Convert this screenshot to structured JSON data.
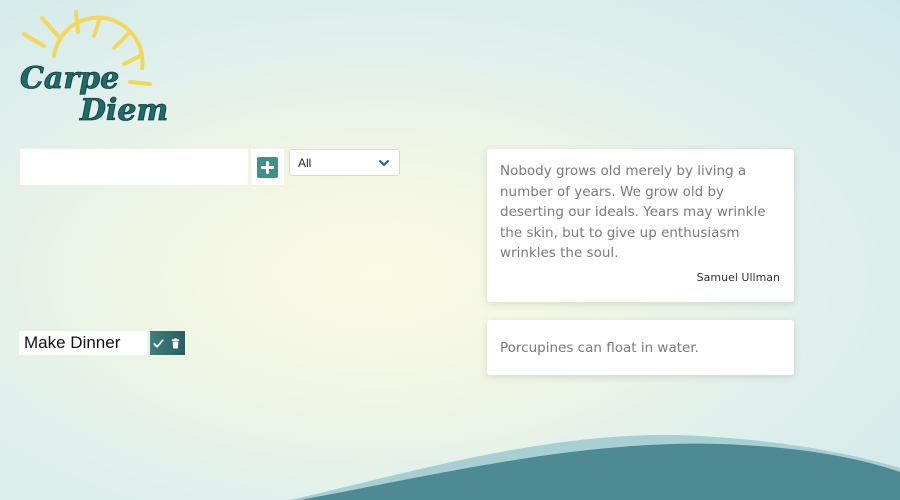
{
  "logo": {
    "line1": "Carpe",
    "line2": "Diem"
  },
  "todo_form": {
    "input_value": "",
    "add_icon": "plus-square-icon",
    "filter_value": "All"
  },
  "todos": [
    {
      "text": "Make Dinner"
    }
  ],
  "quote": {
    "text": "Nobody grows old merely by living a number of years. We grow old by deserting our ideals. Years may wrinkle the skin, but to give up enthusiasm wrinkles the soul.",
    "author": "Samuel Ullman"
  },
  "fact": {
    "text": "Porcupines can float in water."
  },
  "colors": {
    "accent": "#3f8f8c",
    "sun": "#f2d75a",
    "wave": "#4d8a94"
  }
}
